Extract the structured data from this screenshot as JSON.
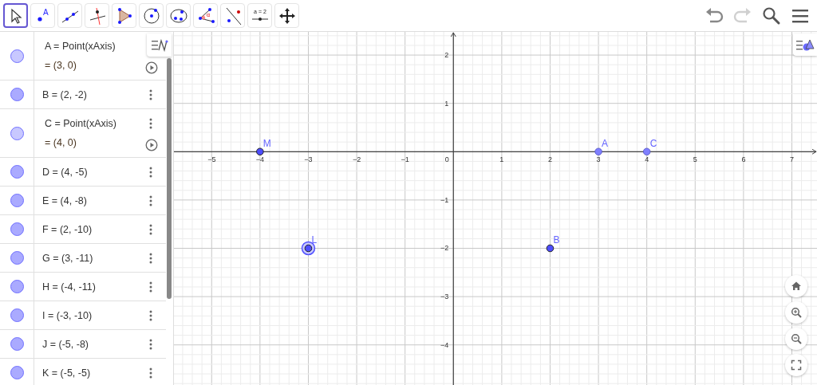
{
  "toolbar": {
    "tools": [
      {
        "kind": "move",
        "selected": true
      },
      {
        "kind": "point",
        "label": "A",
        "selected": false
      },
      {
        "kind": "line",
        "selected": false
      },
      {
        "kind": "perpendicular",
        "selected": false
      },
      {
        "kind": "polygon",
        "selected": false
      },
      {
        "kind": "circle",
        "selected": false
      },
      {
        "kind": "conic",
        "selected": false
      },
      {
        "kind": "angle",
        "label": "α",
        "selected": false
      },
      {
        "kind": "reflect",
        "selected": false
      },
      {
        "kind": "slider",
        "label": "a = 2",
        "selected": false
      },
      {
        "kind": "move-view",
        "selected": false
      }
    ],
    "actions": [
      {
        "kind": "undo",
        "disabled": false
      },
      {
        "kind": "redo",
        "disabled": true
      },
      {
        "kind": "search",
        "disabled": false
      },
      {
        "kind": "menu",
        "disabled": false
      }
    ]
  },
  "algebra": {
    "items": [
      {
        "kind": "dependent",
        "definition": "A = Point(xAxis)",
        "value": "= (3, 0)",
        "color": "#c8c8ff",
        "menu_button": false
      },
      {
        "kind": "free",
        "definition": "B = (2, -2)",
        "color": "#aaaaff",
        "menu_button": true
      },
      {
        "kind": "dependent",
        "definition": "C = Point(xAxis)",
        "value": "= (4, 0)",
        "color": "#c8c8ff",
        "menu_button": true
      },
      {
        "kind": "free",
        "definition": "D = (4, -5)",
        "color": "#aaaaff",
        "menu_button": true
      },
      {
        "kind": "free",
        "definition": "E = (4, -8)",
        "color": "#aaaaff",
        "menu_button": true
      },
      {
        "kind": "free",
        "definition": "F = (2, -10)",
        "color": "#aaaaff",
        "menu_button": true
      },
      {
        "kind": "free",
        "definition": "G = (3, -11)",
        "color": "#aaaaff",
        "menu_button": true
      },
      {
        "kind": "free",
        "definition": "H = (-4, -11)",
        "color": "#aaaaff",
        "menu_button": true
      },
      {
        "kind": "free",
        "definition": "I = (-3, -10)",
        "color": "#aaaaff",
        "menu_button": true
      },
      {
        "kind": "free",
        "definition": "J = (-5, -8)",
        "color": "#aaaaff",
        "menu_button": true
      },
      {
        "kind": "free",
        "definition": "K = (-5, -5)",
        "color": "#aaaaff",
        "menu_button": true
      }
    ]
  },
  "graphics": {
    "chart_data": {
      "type": "scatter",
      "x": [
        -4,
        3,
        4,
        -3,
        2
      ],
      "series": [
        {
          "color": "#4d4dff",
          "values": [
            0,
            null,
            null,
            -2,
            -2
          ]
        },
        {
          "color": "#8080ff",
          "values": [
            null,
            0,
            0,
            null,
            null
          ]
        }
      ],
      "grid": true,
      "xlim": [
        -5.78,
        7.52
      ],
      "ylim": [
        -4.83,
        2.48
      ],
      "xticks": [
        {
          "value": -5,
          "label": "−5"
        },
        {
          "value": -4,
          "label": "−4"
        },
        {
          "value": -3,
          "label": "−3"
        },
        {
          "value": -2,
          "label": "−2"
        },
        {
          "value": -1,
          "label": "−1"
        },
        1,
        2,
        3,
        4,
        5,
        6,
        7
      ],
      "yticks": [
        {
          "value": -4,
          "label": "−4"
        },
        {
          "value": -3,
          "label": "−3"
        },
        {
          "value": -2,
          "label": "−2"
        },
        {
          "value": -1,
          "label": "−1"
        },
        1,
        2
      ],
      "annotations": [
        {
          "text": "M",
          "x": -4,
          "y": 0
        },
        {
          "text": "A",
          "x": 3,
          "y": 0
        },
        {
          "text": "C",
          "x": 4,
          "y": 0
        },
        {
          "text": "L",
          "x": -3,
          "y": -2
        },
        {
          "text": "B",
          "x": 2,
          "y": -2
        }
      ]
    },
    "origin_label": "0",
    "point_selection": [
      false,
      false,
      false,
      true,
      false
    ],
    "view_buttons": [
      {
        "kind": "home"
      },
      {
        "kind": "zoom-in"
      },
      {
        "kind": "zoom-out"
      },
      {
        "kind": "fullscreen"
      }
    ]
  }
}
